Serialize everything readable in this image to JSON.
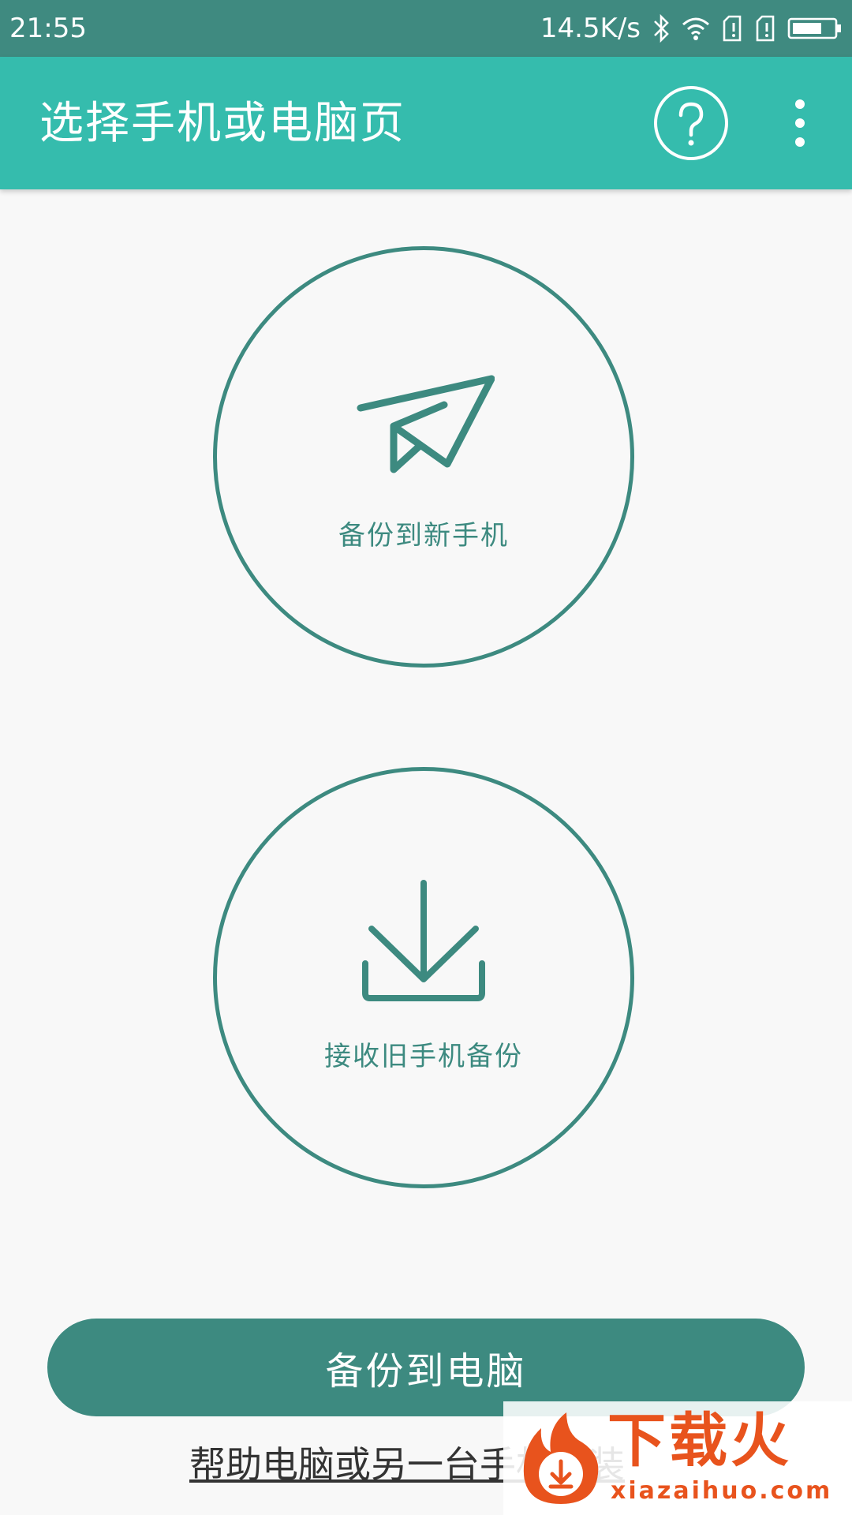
{
  "status_bar": {
    "time": "21:55",
    "network_speed": "14.5K/s",
    "icons": [
      "bluetooth-icon",
      "wifi-icon",
      "sim1-icon",
      "sim2-icon",
      "battery-icon"
    ]
  },
  "app_bar": {
    "title": "选择手机或电脑页",
    "actions": [
      "help-icon",
      "more-vert-icon"
    ]
  },
  "options": {
    "send": {
      "label": "备份到新手机",
      "icon": "paper-plane-icon"
    },
    "receive": {
      "label": "接收旧手机备份",
      "icon": "download-icon"
    }
  },
  "backup_pc_button": "备份到电脑",
  "help_link": "帮助电脑或另一台手机安装",
  "watermark": {
    "text": "下载火",
    "url": "xiazaihuo.com"
  },
  "colors": {
    "status_bar": "#3f8a80",
    "app_bar": "#35bcad",
    "accent": "#3d8a80",
    "background": "#f8f8f8",
    "watermark": "#e8531d"
  }
}
